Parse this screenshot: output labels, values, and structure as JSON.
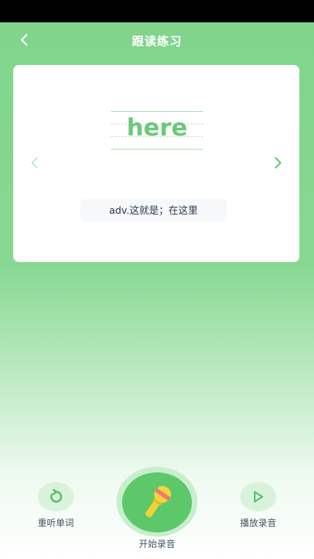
{
  "header": {
    "title": "跟读练习",
    "back_icon": "chevron-left-icon"
  },
  "card": {
    "word": "here",
    "meaning": "adv.这就是；在这里",
    "prev_icon": "chevron-left-icon",
    "next_icon": "chevron-right-icon"
  },
  "controls": {
    "replay_label": "重听单词",
    "record_label": "开始录音",
    "play_label": "播放录音"
  },
  "colors": {
    "accent": "#5cc86a",
    "word": "#6cc97a",
    "text": "#445060"
  }
}
